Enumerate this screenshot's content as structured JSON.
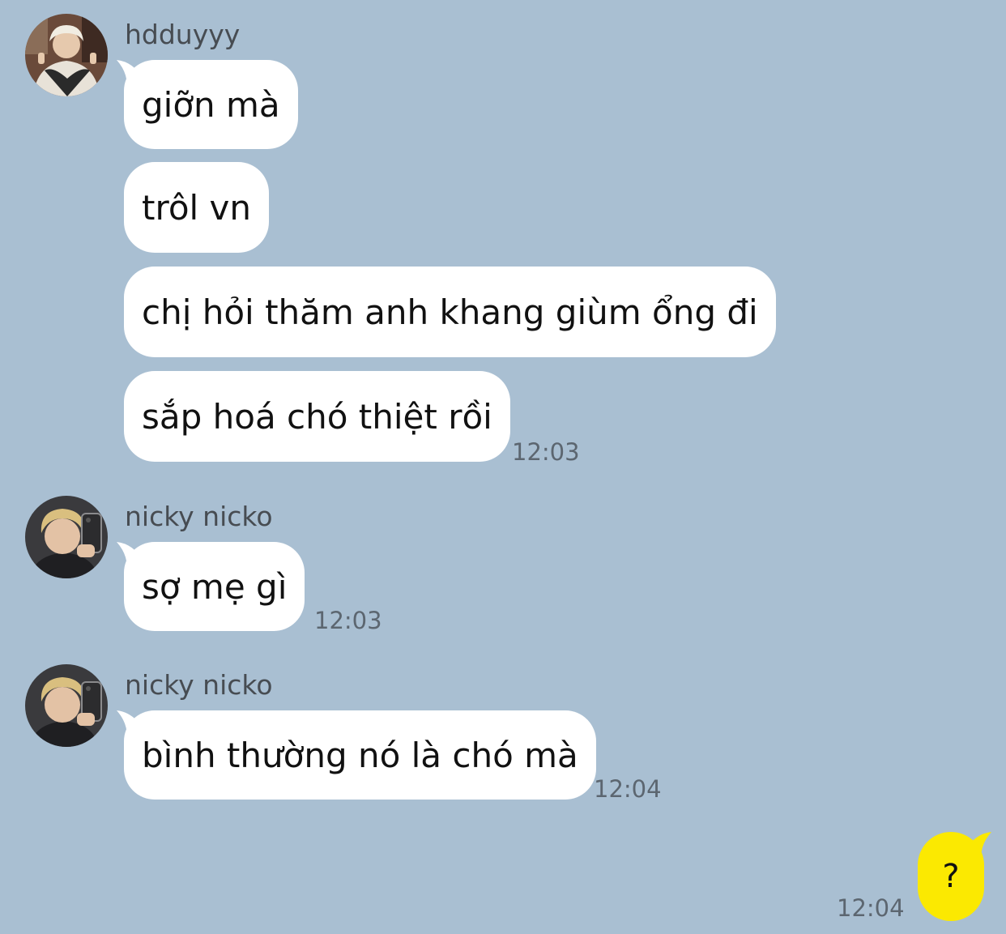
{
  "chat": {
    "groups": [
      {
        "sender": "hdduyyy",
        "messages": [
          "giỡn mà",
          "trôl vn",
          "chị hỏi thăm anh khang giùm ổng đi",
          "sắp hoá chó thiệt rồi"
        ],
        "time": "12:03"
      },
      {
        "sender": "nicky nicko",
        "messages": [
          "sợ mẹ gì"
        ],
        "time": "12:03"
      },
      {
        "sender": "nicky nicko",
        "messages": [
          "bình thường nó là chó mà"
        ],
        "time": "12:04"
      }
    ],
    "mine": {
      "text": "?",
      "time": "12:04"
    }
  },
  "colors": {
    "background": "#a9bfd2",
    "incoming_bubble": "#ffffff",
    "outgoing_bubble": "#fbe901"
  }
}
